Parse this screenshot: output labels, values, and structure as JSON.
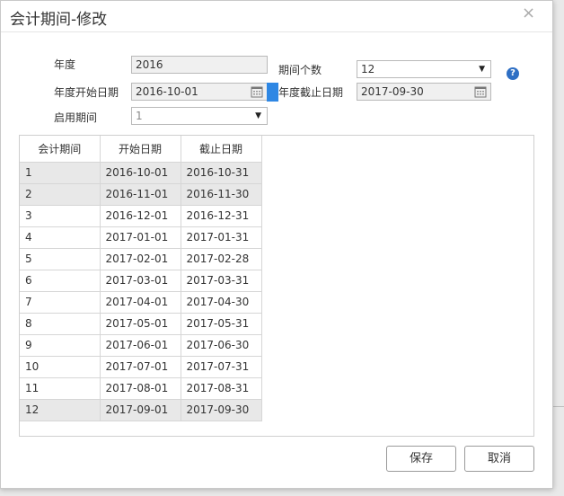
{
  "dialog": {
    "title": "会计期间-修改",
    "close_glyph": "×"
  },
  "form": {
    "year_label": "年度",
    "year_value": "2016",
    "period_count_label": "期间个数",
    "period_count_value": "12",
    "start_date_label": "年度开始日期",
    "start_date_value": "2016-10-01",
    "end_date_label": "年度截止日期",
    "end_date_value": "2017-09-30",
    "enable_period_label": "启用期间",
    "enable_period_value": "1",
    "help_glyph": "?"
  },
  "grid": {
    "headers": [
      "会计期间",
      "开始日期",
      "截止日期"
    ],
    "rows": [
      [
        "1",
        "2016-10-01",
        "2016-10-31"
      ],
      [
        "2",
        "2016-11-01",
        "2016-11-30"
      ],
      [
        "3",
        "2016-12-01",
        "2016-12-31"
      ],
      [
        "4",
        "2017-01-01",
        "2017-01-31"
      ],
      [
        "5",
        "2017-02-01",
        "2017-02-28"
      ],
      [
        "6",
        "2017-03-01",
        "2017-03-31"
      ],
      [
        "7",
        "2017-04-01",
        "2017-04-30"
      ],
      [
        "8",
        "2017-05-01",
        "2017-05-31"
      ],
      [
        "9",
        "2017-06-01",
        "2017-06-30"
      ],
      [
        "10",
        "2017-07-01",
        "2017-07-31"
      ],
      [
        "11",
        "2017-08-01",
        "2017-08-31"
      ],
      [
        "12",
        "2017-09-01",
        "2017-09-30"
      ]
    ]
  },
  "buttons": {
    "save_label": "保存",
    "cancel_label": "取消"
  },
  "icons": {
    "close": "close-icon",
    "calendar": "calendar-icon",
    "dropdown": "chevron-down-icon",
    "help": "help-icon"
  },
  "colors": {
    "accent_blue": "#2e87e4",
    "help_blue": "#2e6fc4",
    "shaded_row": "#e8e8e8"
  }
}
